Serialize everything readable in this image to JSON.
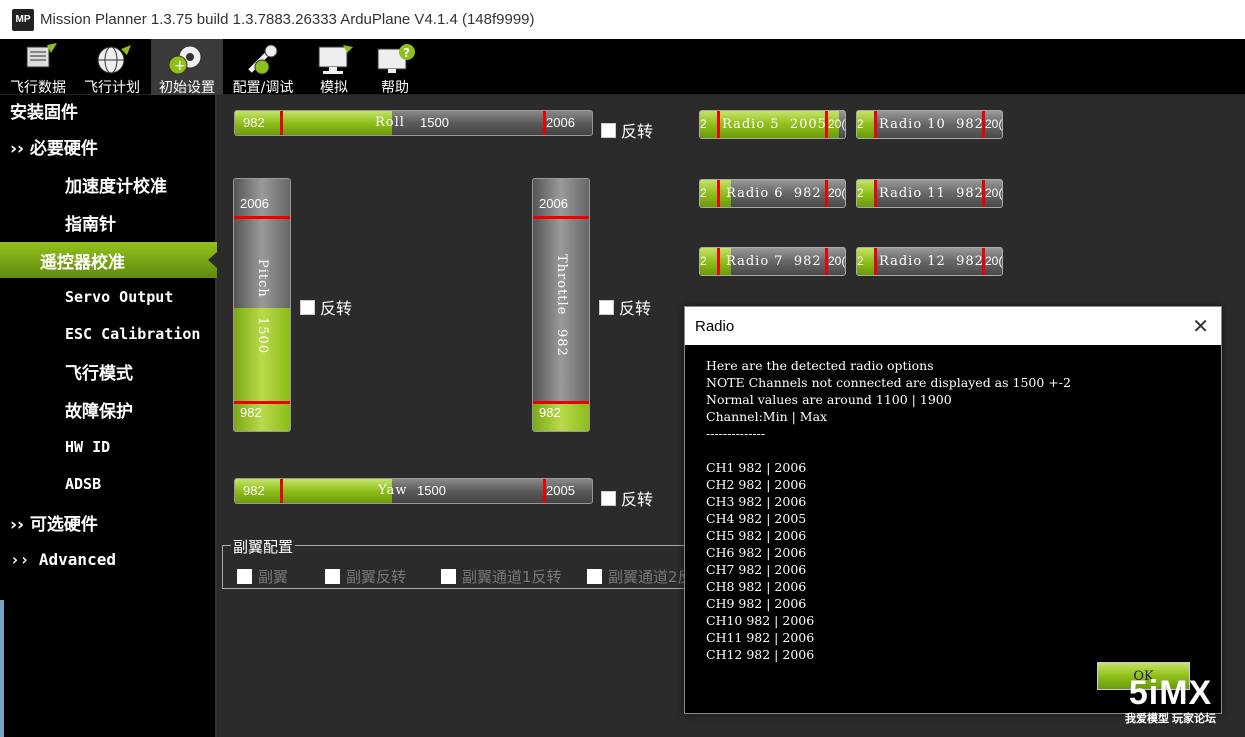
{
  "window": {
    "title": "Mission Planner 1.3.75 build 1.3.7883.26333 ArduPlane V4.1.4 (148f9999)",
    "logo": "MP"
  },
  "toolbar": {
    "items": [
      {
        "label": "飞行数据",
        "icon": "flight-data-icon"
      },
      {
        "label": "飞行计划",
        "icon": "flight-plan-icon"
      },
      {
        "label": "初始设置",
        "icon": "initial-setup-icon"
      },
      {
        "label": "配置/调试",
        "icon": "config-tuning-icon"
      },
      {
        "label": "模拟",
        "icon": "simulation-icon"
      },
      {
        "label": "帮助",
        "icon": "help-icon"
      }
    ],
    "active": "初始设置"
  },
  "sidebar": {
    "items": [
      {
        "label": "安装固件"
      },
      {
        "label": "›› 必要硬件"
      },
      {
        "label": "加速度计校准"
      },
      {
        "label": "指南针"
      },
      {
        "label": "遥控器校准"
      },
      {
        "label": "Servo Output"
      },
      {
        "label": "ESC Calibration"
      },
      {
        "label": "飞行模式"
      },
      {
        "label": "故障保护"
      },
      {
        "label": "HW ID"
      },
      {
        "label": "ADSB"
      },
      {
        "label": "›› 可选硬件"
      },
      {
        "label": "›› Advanced"
      }
    ],
    "active": "遥控器校准"
  },
  "channels": {
    "roll": {
      "label": "Roll",
      "min": "982",
      "value": "1500",
      "max": "2006",
      "fill_fraction": 0.34,
      "reverse_label": "反转"
    },
    "pitch": {
      "label": "Pitch",
      "min": "982",
      "value": "1500",
      "max": "2006",
      "fill_fraction": 0.49,
      "reverse_label": "反转"
    },
    "throttle": {
      "label": "Throttle",
      "min": "982",
      "value": "982",
      "max": "2006",
      "fill_fraction": 0.11,
      "reverse_label": "反转"
    },
    "yaw": {
      "label": "Yaw",
      "min": "982",
      "value": "1500",
      "max": "2005",
      "fill_fraction": 0.34,
      "reverse_label": "反转"
    }
  },
  "radios": [
    {
      "label": "Radio 5",
      "value": "2005",
      "left": "2",
      "right": "20(",
      "fill_fraction": 0.99
    },
    {
      "label": "Radio 10",
      "value": "982",
      "left": "2",
      "right": "20(",
      "fill_fraction": 0.0
    },
    {
      "label": "Radio 6",
      "value": "982",
      "left": "2",
      "right": "20(",
      "fill_fraction": 0.11
    },
    {
      "label": "Radio 11",
      "value": "982",
      "left": "2",
      "right": "20(",
      "fill_fraction": 0.0
    },
    {
      "label": "Radio 7",
      "value": "982",
      "left": "2",
      "right": "20(",
      "fill_fraction": 0.11
    },
    {
      "label": "Radio 12",
      "value": "982",
      "left": "2",
      "right": "20(",
      "fill_fraction": 0.0
    }
  ],
  "aileron": {
    "legend": "副翼配置",
    "options": [
      "副翼",
      "副翼反转",
      "副翼通道1反转",
      "副翼通道2反"
    ]
  },
  "dialog": {
    "title": "Radio",
    "close": "✕",
    "body": "Here are the detected radio options\nNOTE Channels not connected are displayed as 1500 +-2\nNormal values are around 1100 | 1900\nChannel:Min | Max\n--------------\n\nCH1 982 | 2006\nCH2 982 | 2006\nCH3 982 | 2006\nCH4 982 | 2005\nCH5 982 | 2006\nCH6 982 | 2006\nCH7 982 | 2006\nCH8 982 | 2006\nCH9 982 | 2006\nCH10 982 | 2006\nCH11 982 | 2006\nCH12 982 | 2006",
    "ok": "OK"
  },
  "watermark": {
    "brand": "5iMX",
    "tagline": "我爱模型 玩家论坛"
  },
  "colors": {
    "accent": "#8fbf1a",
    "marker": "#ee0000",
    "background": "#2b2b2b"
  }
}
